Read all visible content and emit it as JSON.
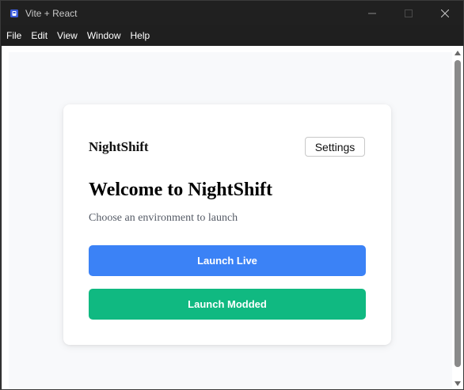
{
  "window": {
    "title": "Vite + React"
  },
  "menubar": {
    "items": [
      "File",
      "Edit",
      "View",
      "Window",
      "Help"
    ]
  },
  "card": {
    "brand": "NightShift",
    "settings_label": "Settings",
    "heading": "Welcome to NightShift",
    "subtitle": "Choose an environment to launch",
    "launch_live_label": "Launch Live",
    "launch_modded_label": "Launch Modded"
  },
  "colors": {
    "launch_live": "#3b82f6",
    "launch_modded": "#10b981",
    "titlebar": "#202020"
  },
  "icons": {
    "app": "app-icon",
    "minimize": "minimize-icon",
    "maximize": "maximize-icon",
    "close": "close-icon"
  }
}
